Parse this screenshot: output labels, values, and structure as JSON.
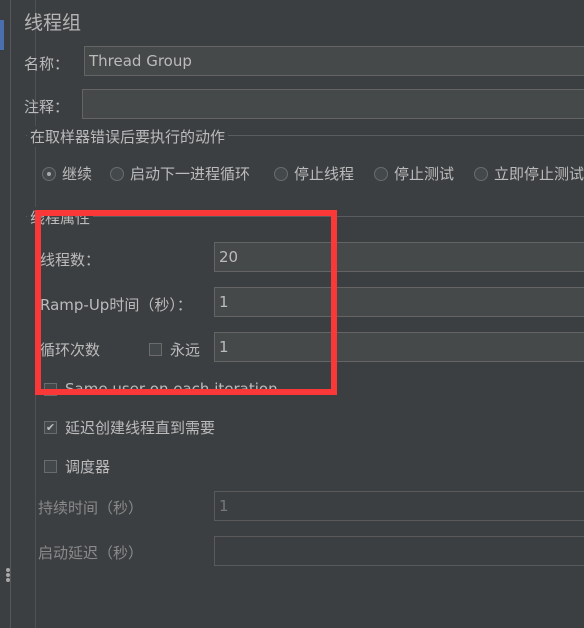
{
  "panel": {
    "title": "线程组",
    "name_label": "名称：",
    "name_value": "Thread Group",
    "comment_label": "注释：",
    "comment_value": ""
  },
  "sampler_error": {
    "title": "在取样器错误后要执行的动作",
    "options": [
      {
        "label": "继续",
        "checked": true
      },
      {
        "label": "启动下一进程循环",
        "checked": false
      },
      {
        "label": "停止线程",
        "checked": false
      },
      {
        "label": "停止测试",
        "checked": false
      },
      {
        "label": "立即停止测试",
        "checked": false
      }
    ]
  },
  "thread_props": {
    "title": "线程属性",
    "threads_label": "线程数：",
    "threads_value": "20",
    "rampup_label": "Ramp-Up时间（秒）：",
    "rampup_value": "1",
    "loop_label": "循环次数",
    "forever_label": "永远",
    "forever_checked": false,
    "loop_value": "1",
    "same_user_label": "Same user on each iteration",
    "same_user_checked": false,
    "delay_label": "延迟创建线程直到需要",
    "delay_checked": true,
    "scheduler_label": "调度器",
    "scheduler_checked": false,
    "duration_label": "持续时间（秒）",
    "duration_value": "1",
    "startup_delay_label": "启动延迟（秒）",
    "startup_delay_value": ""
  },
  "annotation": {
    "highlight_color": "#fb3838"
  },
  "icons": {
    "check": "✔"
  }
}
